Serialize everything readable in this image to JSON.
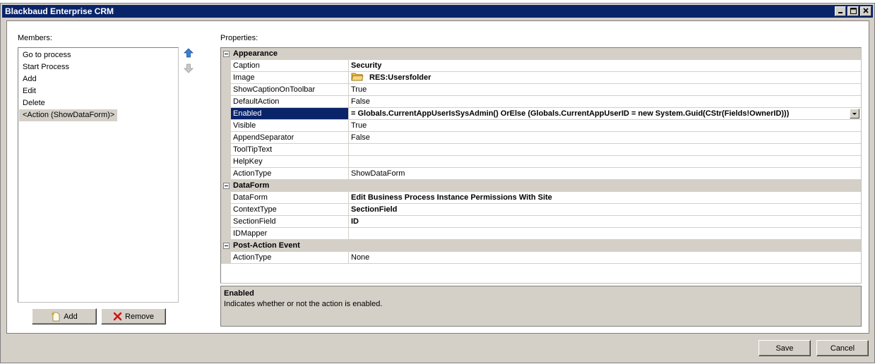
{
  "window": {
    "title": "Blackbaud Enterprise CRM"
  },
  "members": {
    "label": "Members:",
    "items": [
      "Go to process",
      "Start Process",
      "Add",
      "Edit",
      "Delete",
      "<Action (ShowDataForm)>"
    ],
    "add_label": "Add",
    "remove_label": "Remove"
  },
  "properties": {
    "label": "Properties:",
    "categories": [
      {
        "name": "Appearance",
        "rows": [
          {
            "name": "Caption",
            "value": "Security"
          },
          {
            "name": "Image",
            "value": "RES:Usersfolder"
          },
          {
            "name": "ShowCaptionOnToolbar",
            "value": "True"
          },
          {
            "name": "DefaultAction",
            "value": "False"
          },
          {
            "name": "Enabled",
            "value": "= Globals.CurrentAppUserIsSysAdmin() OrElse (Globals.CurrentAppUserID = new System.Guid(CStr(Fields!OwnerID)))"
          },
          {
            "name": "Visible",
            "value": "True"
          },
          {
            "name": "AppendSeparator",
            "value": "False"
          },
          {
            "name": "ToolTipText",
            "value": ""
          },
          {
            "name": "HelpKey",
            "value": ""
          },
          {
            "name": "ActionType",
            "value": "ShowDataForm"
          }
        ]
      },
      {
        "name": "DataForm",
        "rows": [
          {
            "name": "DataForm",
            "value": "Edit Business Process Instance Permissions With Site"
          },
          {
            "name": "ContextType",
            "value": "SectionField"
          },
          {
            "name": "SectionField",
            "value": "ID"
          },
          {
            "name": "IDMapper",
            "value": ""
          }
        ]
      },
      {
        "name": "Post-Action Event",
        "rows": [
          {
            "name": "ActionType",
            "value": "None"
          }
        ]
      }
    ]
  },
  "description": {
    "title": "Enabled",
    "text": "Indicates whether or not the action is enabled."
  },
  "footer": {
    "save_label": "Save",
    "cancel_label": "Cancel"
  },
  "colors": {
    "titlebar": "#0a246a",
    "selection": "#0a246a",
    "chrome": "#d4d0c8"
  }
}
